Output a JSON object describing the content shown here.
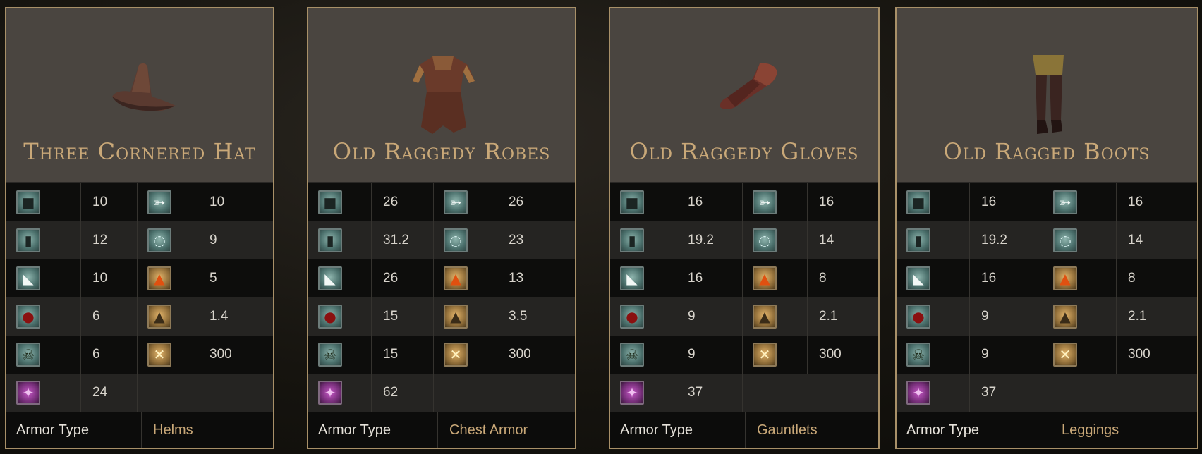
{
  "cards": [
    {
      "name": "Three Cornered Hat",
      "art": "hat",
      "stats": [
        [
          "10",
          "10"
        ],
        [
          "12",
          "9"
        ],
        [
          "10",
          "5"
        ],
        [
          "6",
          "1.4"
        ],
        [
          "6",
          "300"
        ],
        [
          "24",
          ""
        ]
      ],
      "armor_type_label": "Armor Type",
      "armor_type": "Helms"
    },
    {
      "name": "Old Raggedy Robes",
      "art": "robe",
      "stats": [
        [
          "26",
          "26"
        ],
        [
          "31.2",
          "23"
        ],
        [
          "26",
          "13"
        ],
        [
          "15",
          "3.5"
        ],
        [
          "15",
          "300"
        ],
        [
          "62",
          ""
        ]
      ],
      "armor_type_label": "Armor Type",
      "armor_type": "Chest Armor"
    },
    {
      "name": "Old Raggedy Gloves",
      "art": "glove",
      "stats": [
        [
          "16",
          "16"
        ],
        [
          "19.2",
          "14"
        ],
        [
          "16",
          "8"
        ],
        [
          "9",
          "2.1"
        ],
        [
          "9",
          "300"
        ],
        [
          "37",
          ""
        ]
      ],
      "armor_type_label": "Armor Type",
      "armor_type": "Gauntlets"
    },
    {
      "name": "Old Ragged Boots",
      "art": "boots",
      "stats": [
        [
          "16",
          "16"
        ],
        [
          "19.2",
          "14"
        ],
        [
          "16",
          "8"
        ],
        [
          "9",
          "2.1"
        ],
        [
          "9",
          "300"
        ],
        [
          "37",
          ""
        ]
      ],
      "armor_type_label": "Armor Type",
      "armor_type": "Leggings"
    }
  ],
  "icons_left": [
    "physical-armor-icon",
    "strike-armor-icon",
    "slash-armor-icon",
    "bleed-resist-icon",
    "poison-resist-icon",
    "magic-armor-icon"
  ],
  "icons_right": [
    "thrust-armor-icon",
    "magic-defense-icon",
    "fire-defense-icon",
    "weight-icon",
    "durability-icon"
  ]
}
